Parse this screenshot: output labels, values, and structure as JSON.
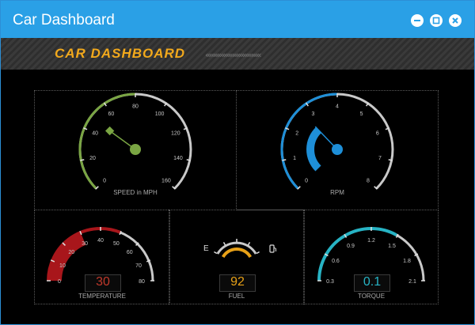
{
  "window": {
    "title": "Car Dashboard"
  },
  "banner": {
    "title": "CAR DASHBOARD"
  },
  "colors": {
    "titlebar": "#2aa0e6",
    "speed": "#7aa543",
    "rpm": "#1e8fd8",
    "temperature": "#a8161b",
    "fuel": "#e8a117",
    "torque": "#27b3c4"
  },
  "gauges": {
    "speed": {
      "label": "SPEED in MPH",
      "min": 0,
      "max": 160,
      "value": 48,
      "ticks": [
        "0",
        "20",
        "40",
        "60",
        "80",
        "100",
        "120",
        "140",
        "160"
      ]
    },
    "rpm": {
      "label": "RPM",
      "min": 0,
      "max": 8,
      "value": 2.7,
      "ticks": [
        "0",
        "1",
        "2",
        "3",
        "4",
        "5",
        "6",
        "7",
        "8"
      ]
    },
    "temperature": {
      "label": "TEMPERATURE",
      "min": 0,
      "max": 80,
      "value": 30,
      "value_text": "30",
      "ticks": [
        "0",
        "10",
        "20",
        "30",
        "40",
        "50",
        "60",
        "70",
        "80"
      ]
    },
    "fuel": {
      "label": "FUEL",
      "empty_mark": "E",
      "value_text": "92",
      "value": 92
    },
    "torque": {
      "label": "TORQUE",
      "min": 0.3,
      "max": 2.1,
      "value": 0.1,
      "value_text": "0.1",
      "ticks": [
        "0.3",
        "0.6",
        "0.9",
        "1.2",
        "1.5",
        "1.8",
        "2.1"
      ]
    }
  }
}
